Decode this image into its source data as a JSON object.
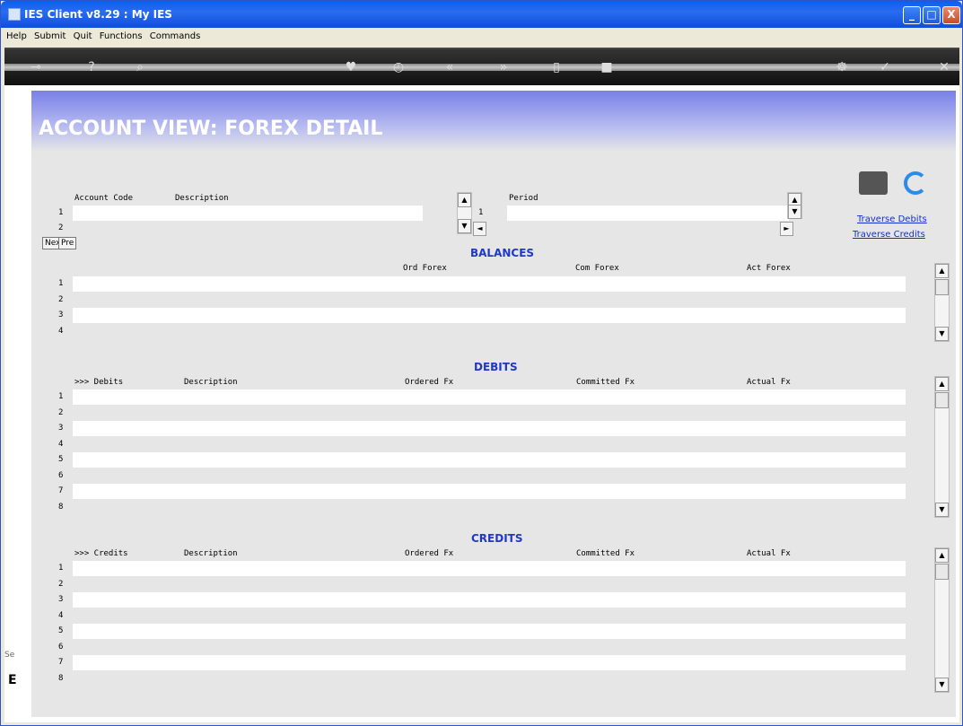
{
  "window": {
    "title": "IES Client v8.29 : My IES",
    "min": "_",
    "max": "□",
    "close": "X"
  },
  "menu": [
    "Help",
    "Submit",
    "Quit",
    "Functions",
    "Commands"
  ],
  "page_title": "ACCOUNT VIEW: FOREX DETAIL",
  "account": {
    "col_code": "Account Code",
    "col_desc": "Description",
    "rows": [
      "1",
      "2"
    ],
    "nex": "Nex",
    "pre": "Pre"
  },
  "period": {
    "col": "Period",
    "rows": [
      "1"
    ]
  },
  "links": {
    "debits": "Traverse Debits",
    "credits": "Traverse Credits"
  },
  "balances": {
    "title": "BALANCES",
    "cols": [
      "Ord Forex",
      "Com Forex",
      "Act Forex"
    ],
    "rows": [
      "1",
      "2",
      "3",
      "4"
    ]
  },
  "debits": {
    "title": "DEBITS",
    "cols": [
      ">>> Debits",
      "Description",
      "Ordered Fx",
      "Committed Fx",
      "Actual Fx"
    ],
    "rows": [
      "1",
      "2",
      "3",
      "4",
      "5",
      "6",
      "7",
      "8"
    ]
  },
  "credits": {
    "title": "CREDITS",
    "cols": [
      ">>> Credits",
      "Description",
      "Ordered Fx",
      "Committed Fx",
      "Actual Fx"
    ],
    "rows": [
      "1",
      "2",
      "3",
      "4",
      "5",
      "6",
      "7",
      "8"
    ]
  },
  "side": {
    "label": "Se",
    "mark": "E"
  }
}
